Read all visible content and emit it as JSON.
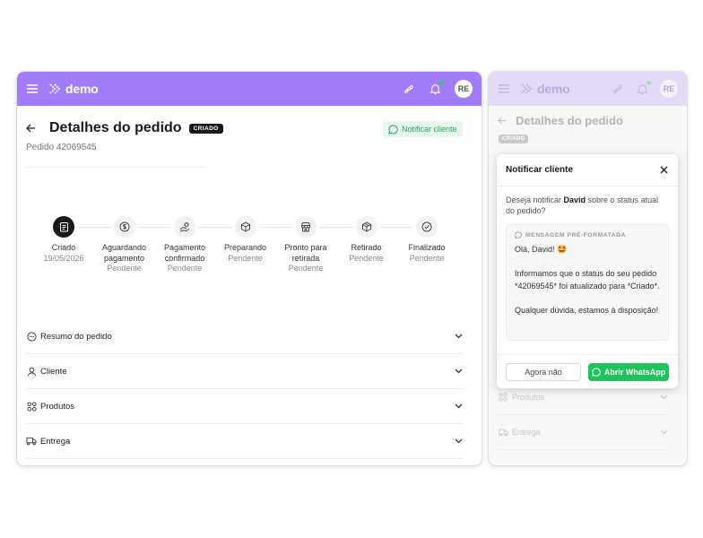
{
  "app": {
    "logo_text": "demo",
    "avatar_initials": "RE"
  },
  "order": {
    "title": "Detalhes do pedido",
    "status_badge": "CRIADO",
    "subtitle": "Pedido 42069545",
    "notify_label": "Notificar cliente"
  },
  "timeline": [
    {
      "label": "Criado",
      "status": "19/05/2026",
      "icon": "clipboard-icon",
      "active": true
    },
    {
      "label": "Aguardando pagamento",
      "status": "Pendente",
      "icon": "dollar-icon",
      "active": false
    },
    {
      "label": "Pagamento confirmado",
      "status": "Pendente",
      "icon": "hand-coin-icon",
      "active": false
    },
    {
      "label": "Preparando",
      "status": "Pendente",
      "icon": "box-icon",
      "active": false
    },
    {
      "label": "Pronto para retirada",
      "status": "Pendente",
      "icon": "store-icon",
      "active": false
    },
    {
      "label": "Retirado",
      "status": "Pendente",
      "icon": "package-icon",
      "active": false
    },
    {
      "label": "Finalizado",
      "status": "Pendente",
      "icon": "check-circle-icon",
      "active": false
    }
  ],
  "sections": [
    {
      "label": "Resumo do pedido",
      "icon": "dots-circle-icon"
    },
    {
      "label": "Cliente",
      "icon": "user-icon"
    },
    {
      "label": "Produtos",
      "icon": "grid-icon"
    },
    {
      "label": "Entrega",
      "icon": "truck-icon"
    }
  ],
  "modal": {
    "title": "Notificar cliente",
    "question_prefix": "Deseja notificar ",
    "customer_name": "David",
    "question_suffix": " sobre o status atual do pedido?",
    "message_tag": "MENSAGEM PRÉ-FORMATADA",
    "message_text": "Olá, David! 🤩\n\nInformamos que o status do seu pedido *42069545* foi atualizado para *Criado*.\n\nQualquer dúvida, estamos à disposição!",
    "cancel_label": "Agora não",
    "confirm_label": "Abrir WhatsApp"
  },
  "colors": {
    "brand": "#a07cf8",
    "whatsapp": "#1fc35e",
    "dark": "#1a1a1a"
  }
}
